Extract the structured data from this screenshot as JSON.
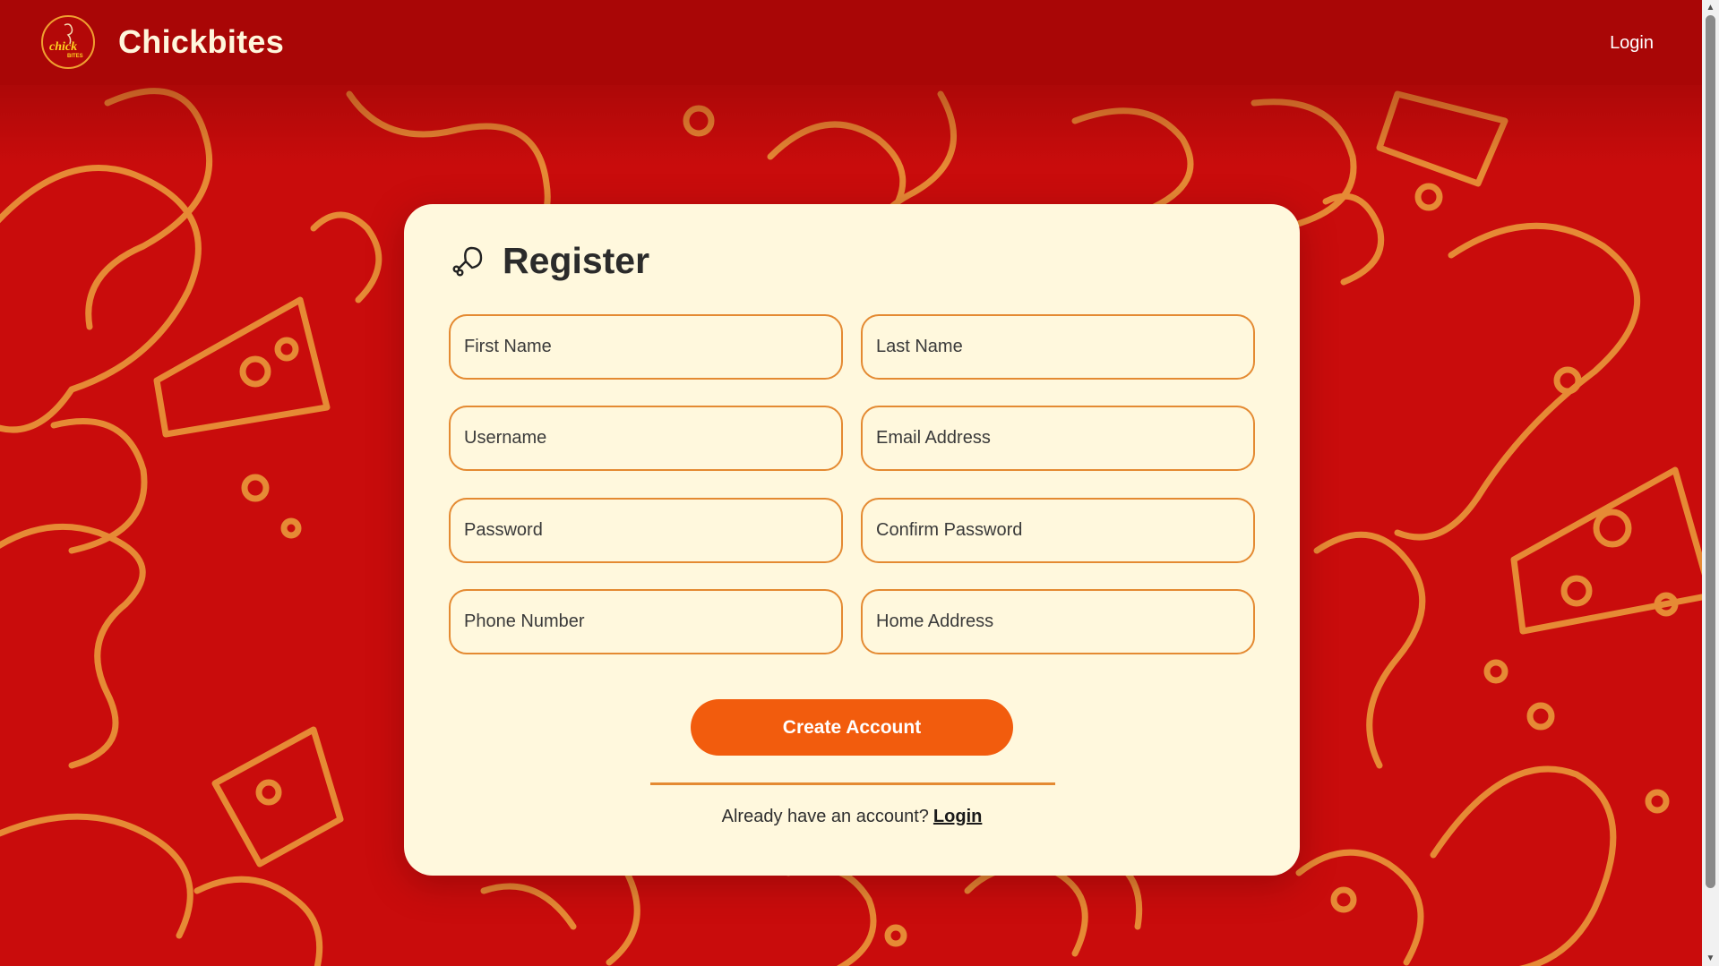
{
  "header": {
    "logo_text_top": "chick",
    "logo_text_bottom": "BITES",
    "brand": "Chickbites",
    "login_label": "Login"
  },
  "colors": {
    "navbar": "#a90606",
    "background": "#c90c0c",
    "pattern": "#e68a35",
    "card": "#fff8dd",
    "field_border": "#e48a32",
    "button": "#f25c0d"
  },
  "register": {
    "icon": "drumstick-icon",
    "title": "Register",
    "fields": {
      "first_name": "First Name",
      "last_name": "Last Name",
      "username": "Username",
      "email": "Email Address",
      "password": "Password",
      "confirm_password": "Confirm Password",
      "phone": "Phone Number",
      "home_address": "Home Address"
    },
    "submit_label": "Create Account",
    "already_text": "Already have an account?",
    "login_link": "Login"
  }
}
